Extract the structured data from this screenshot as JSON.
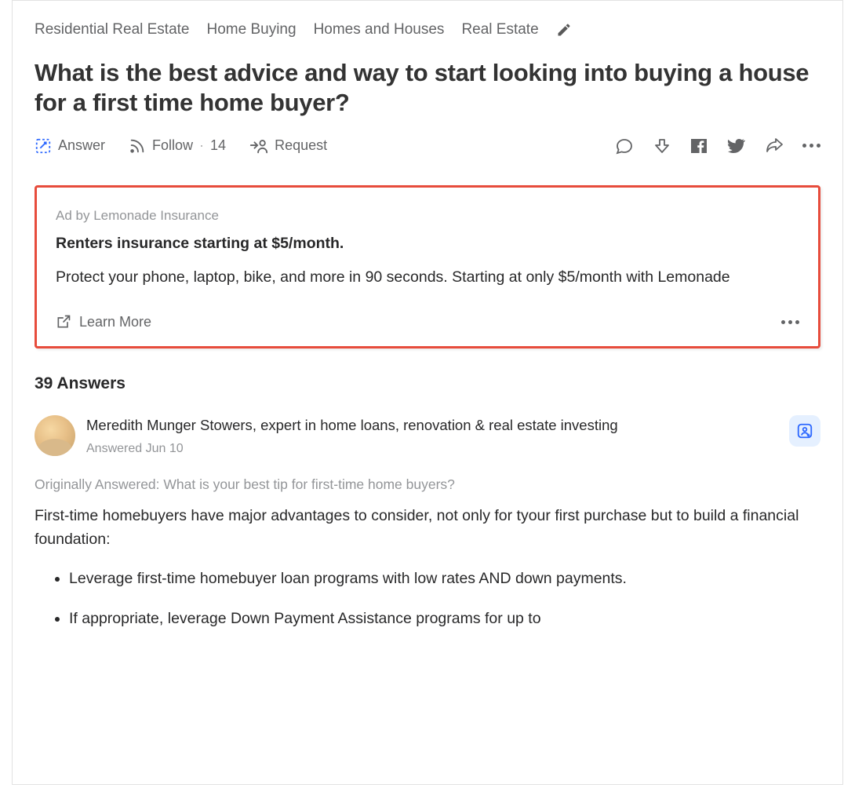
{
  "topics": [
    "Residential Real Estate",
    "Home Buying",
    "Homes and Houses",
    "Real Estate"
  ],
  "question": "What is the best advice and way to start looking into buying a house for a first time home buyer?",
  "actions": {
    "answer": "Answer",
    "follow": "Follow",
    "follow_count": "14",
    "request": "Request"
  },
  "ad": {
    "label": "Ad by Lemonade Insurance",
    "headline": "Renters insurance starting at $5/month.",
    "body": "Protect your phone, laptop, bike, and more in 90 seconds. Starting at only $5/month with Lemonade",
    "cta": "Learn More"
  },
  "answers_heading": "39 Answers",
  "answer": {
    "author_name": "Meredith Munger Stowers",
    "author_cred": ", expert in home loans, renovation & real estate investing",
    "answered": "Answered Jun 10",
    "orig": "Originally Answered: What is your best tip for first-time home buyers?",
    "para": "First-time homebuyers have major advantages to consider, not only for tyour first purchase but to build a financial foundation:",
    "bullets": [
      "Leverage first-time homebuyer loan programs with low rates AND down payments.",
      "If appropriate, leverage Down Payment Assistance programs for up to"
    ]
  }
}
